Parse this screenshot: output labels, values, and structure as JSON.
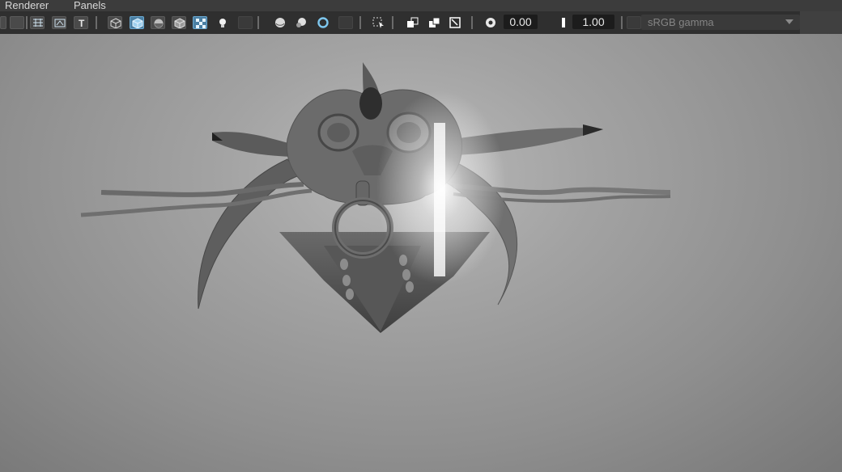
{
  "menubar": {
    "items": [
      "Renderer",
      "Panels"
    ]
  },
  "toolbar": {
    "icons": [
      "camera-select-icon",
      "grid-icon",
      "film-gate-icon",
      "resolution-gate-icon",
      "text-overlay-icon",
      "wireframe-icon",
      "smooth-shade-icon",
      "default-material-icon",
      "wireframe-on-shaded-icon",
      "xray-icon",
      "use-all-lights-icon",
      "shadows-icon",
      "screen-space-ao-icon",
      "motion-blur-icon",
      "anti-aliasing-icon",
      "depth-of-field-icon",
      "isolate-select-icon",
      "xray-joints-icon",
      "xray-active-icon",
      "backface-culling-icon",
      "image-plane-icon",
      "color-management-icon"
    ],
    "exposure_value": "0.00",
    "gamma_value": "1.00",
    "colorspace": "sRGB gamma"
  },
  "viewport": {
    "model": "sculpted-creature-mesh"
  }
}
